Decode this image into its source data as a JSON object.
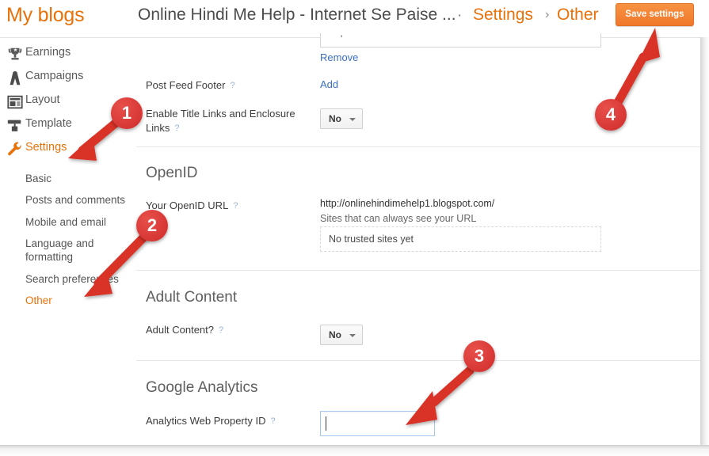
{
  "header": {
    "my_blogs": "My blogs",
    "blog_title": "Online Hindi Me Help - Internet Se Paise ...",
    "separator_dot": "·",
    "crumb_settings": "Settings",
    "crumb_arrow": "›",
    "crumb_other": "Other",
    "save_button": "Save settings",
    "accent_color": "#e8710a",
    "save_button_color": "#f5873a"
  },
  "sidebar": {
    "main_items": [
      {
        "label": "Earnings",
        "icon": "trophy-icon",
        "active": false
      },
      {
        "label": "Campaigns",
        "icon": "campaign-icon",
        "active": false
      },
      {
        "label": "Layout",
        "icon": "layout-icon",
        "active": false
      },
      {
        "label": "Template",
        "icon": "paint-roller-icon",
        "active": false
      },
      {
        "label": "Settings",
        "icon": "wrench-icon",
        "active": true
      }
    ],
    "sub_items": [
      {
        "label": "Basic",
        "active": false
      },
      {
        "label": "Posts and comments",
        "active": false
      },
      {
        "label": "Mobile and email",
        "active": false
      },
      {
        "label": "Language and formatting",
        "active": false
      },
      {
        "label": "Search preferences",
        "active": false
      },
      {
        "label": "Other",
        "active": true
      }
    ]
  },
  "content": {
    "remove_link": "Remove",
    "post_feed_footer": {
      "label": "Post Feed Footer",
      "help": "?",
      "add_link": "Add"
    },
    "enable_title_links": {
      "label": "Enable Title Links and Enclosure Links",
      "help": "?",
      "value": "No"
    },
    "openid": {
      "section_title": "OpenID",
      "url_label": "Your OpenID URL",
      "help": "?",
      "url_value": "http://onlinehindimehelp1.blogspot.com/",
      "trusted_caption": "Sites that can always see your URL",
      "trusted_value": "No trusted sites yet"
    },
    "adult_content": {
      "section_title": "Adult Content",
      "label": "Adult Content?",
      "help": "?",
      "value": "No"
    },
    "google_analytics": {
      "section_title": "Google Analytics",
      "label": "Analytics Web Property ID",
      "help": "?",
      "input_value": "",
      "input_placeholder": ""
    }
  },
  "annotations": {
    "color": "#d93025",
    "steps": [
      {
        "number": "1",
        "target": "settings-nav"
      },
      {
        "number": "2",
        "target": "other-sub-nav"
      },
      {
        "number": "3",
        "target": "analytics-input"
      },
      {
        "number": "4",
        "target": "save-settings-button"
      }
    ]
  }
}
